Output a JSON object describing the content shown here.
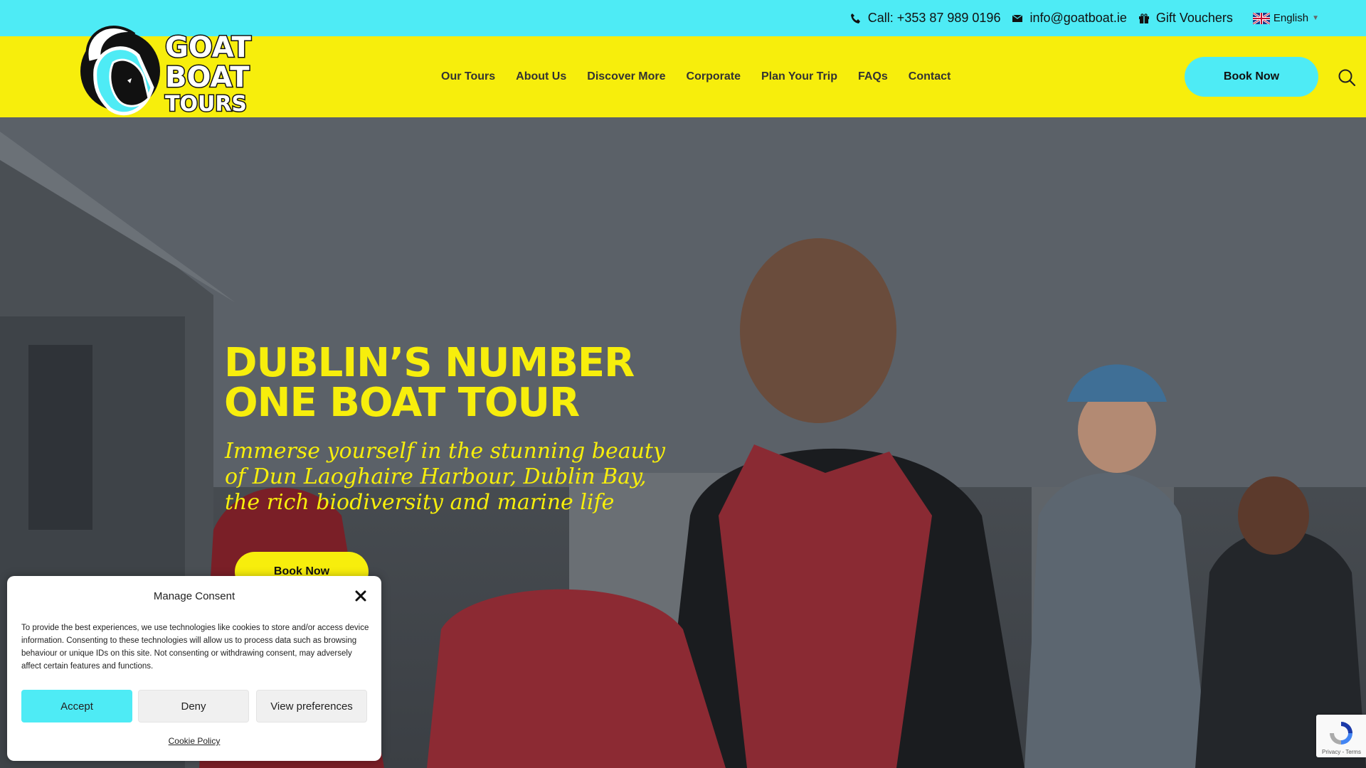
{
  "topbar": {
    "phone": "Call: +353 87 989 0196",
    "email": "info@goatboat.ie",
    "vouchers": "Gift Vouchers",
    "language": "English"
  },
  "logo": {
    "line1": "GOAT",
    "line2": "BOAT",
    "line3": "TOURS"
  },
  "nav": {
    "items": [
      "Our Tours",
      "About Us",
      "Discover More",
      "Corporate",
      "Plan Your Trip",
      "FAQs",
      "Contact"
    ],
    "book_now": "Book Now"
  },
  "hero": {
    "headline": "DUBLIN’S NUMBER ONE BOAT TOUR",
    "subheadline": "Immerse yourself in the stunning beauty of Dun Laoghaire Harbour, Dublin Bay, the rich biodiversity and marine life",
    "book_now": "Book Now"
  },
  "consent": {
    "title": "Manage Consent",
    "text": "To provide the best experiences, we use technologies like cookies to store and/or access device information. Consenting to these technologies will allow us to process data such as browsing behaviour or unique IDs on this site. Not consenting or withdrawing consent, may adversely affect certain features and functions.",
    "accept": "Accept",
    "deny": "Deny",
    "preferences": "View preferences",
    "policy": "Cookie Policy"
  },
  "recaptcha": {
    "label": "Privacy - Terms"
  },
  "colors": {
    "cyan": "#4eebf5",
    "yellow": "#f7ee0c"
  }
}
